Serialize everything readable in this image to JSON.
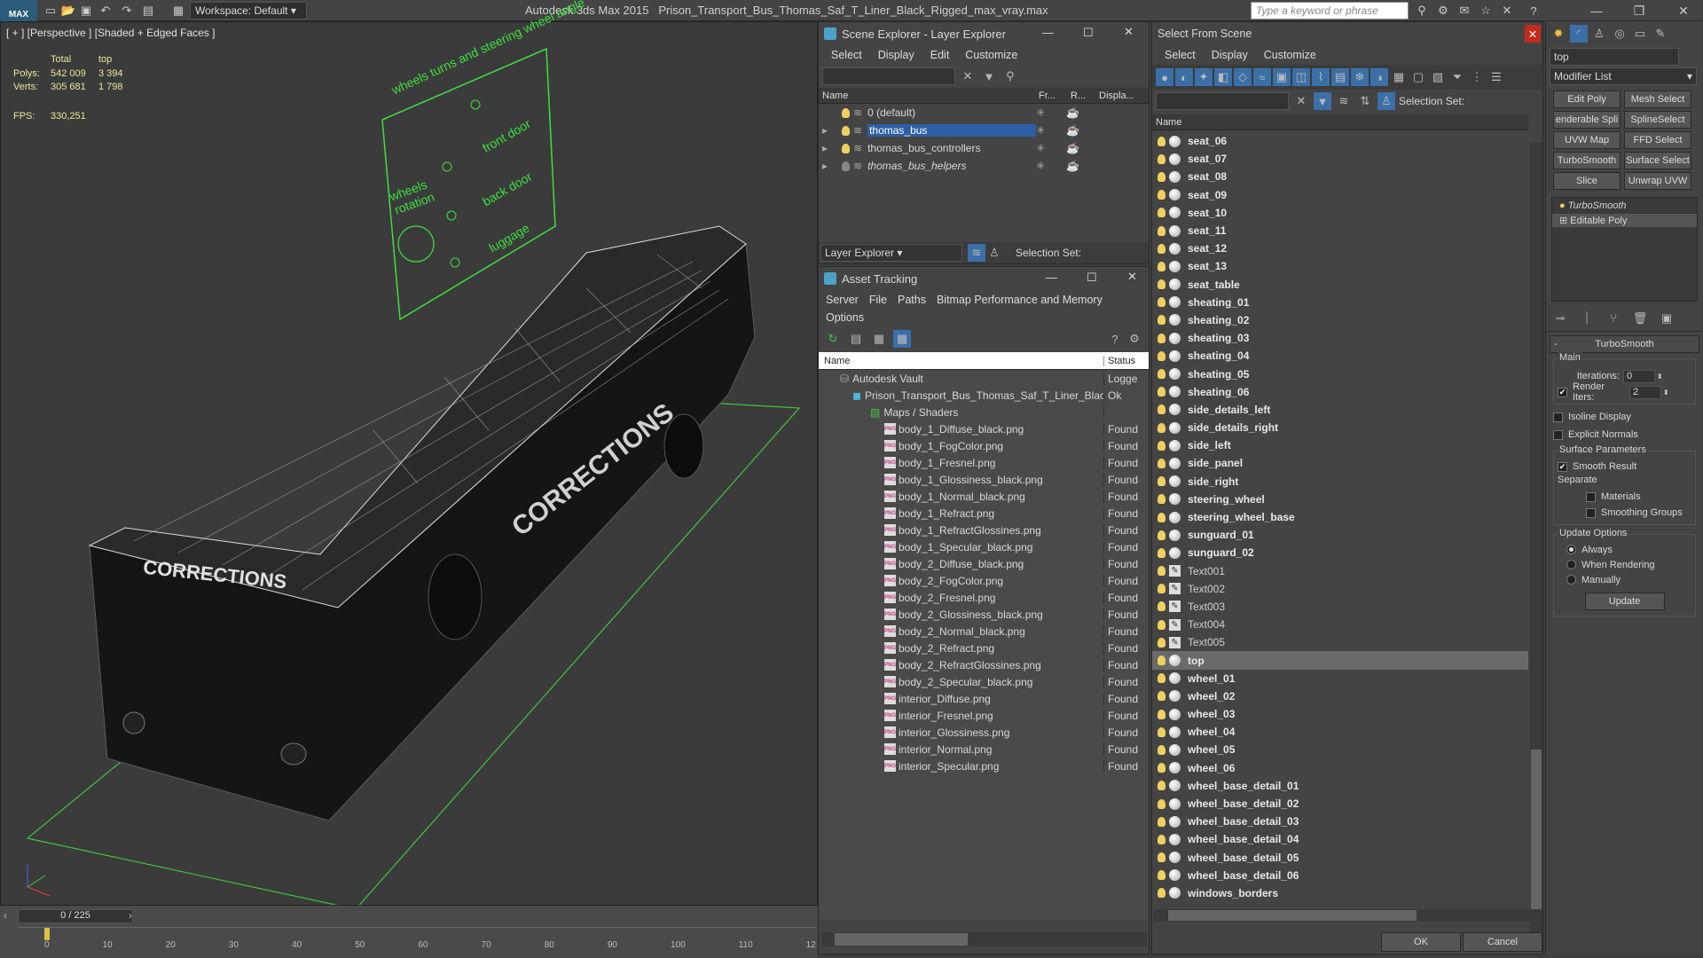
{
  "titlebar": {
    "logo": "MAX",
    "workspace": "Workspace: Default",
    "app_name": "Autodesk 3ds Max  2015",
    "file_name": "Prison_Transport_Bus_Thomas_Saf_T_Liner_Black_Rigged_max_vray.max",
    "search_placeholder": "Type a keyword or phrase"
  },
  "viewport": {
    "label": "[ + ] [Perspective ] [Shaded + Edged Faces ]",
    "stats": {
      "header_total": "Total",
      "header_sel": "top",
      "polys_label": "Polys:",
      "polys_total": "542 009",
      "polys_sel": "3 394",
      "verts_label": "Verts:",
      "verts_total": "305 681",
      "verts_sel": "1 798",
      "fps_label": "FPS:",
      "fps_value": "330,251"
    },
    "overlay_text": {
      "title": "wheels turns and steering wheel angle",
      "front_door": "front door",
      "back_door": "back door",
      "luggage": "luggage",
      "wheels_rotation": "wheels rotation"
    },
    "bus_text": "CORRECTIONS"
  },
  "timeline": {
    "frame": "0 / 225",
    "ticks": [
      "0",
      "10",
      "20",
      "30",
      "40",
      "50",
      "60",
      "70",
      "80",
      "90",
      "100",
      "110",
      "12"
    ]
  },
  "scene_explorer": {
    "title": "Scene Explorer - Layer Explorer",
    "menu": [
      "Select",
      "Display",
      "Edit",
      "Customize"
    ],
    "columns": [
      "Name",
      "Fr...",
      "R...",
      "Displa..."
    ],
    "layers": [
      "0 (default)",
      "thomas_bus",
      "thomas_bus_controllers",
      "thomas_bus_helpers"
    ],
    "footer_label": "Layer Explorer",
    "selection_set": "Selection Set:"
  },
  "asset_tracking": {
    "title": "Asset Tracking",
    "menu": [
      "Server",
      "File",
      "Paths",
      "Bitmap Performance and Memory"
    ],
    "menu2": "Options",
    "columns": [
      "Name",
      "Status"
    ],
    "vault": {
      "name": "Autodesk Vault",
      "status": "Logge"
    },
    "file": {
      "name": "Prison_Transport_Bus_Thomas_Saf_T_Liner_Black...",
      "status": "Ok"
    },
    "maps_label": "Maps / Shaders",
    "maps": [
      "body_1_Diffuse_black.png",
      "body_1_FogColor.png",
      "body_1_Fresnel.png",
      "body_1_Glossiness_black.png",
      "body_1_Normal_black.png",
      "body_1_Refract.png",
      "body_1_RefractGlossines.png",
      "body_1_Specular_black.png",
      "body_2_Diffuse_black.png",
      "body_2_FogColor.png",
      "body_2_Fresnel.png",
      "body_2_Glossiness_black.png",
      "body_2_Normal_black.png",
      "body_2_Refract.png",
      "body_2_RefractGlossines.png",
      "body_2_Specular_black.png",
      "interior_Diffuse.png",
      "interior_Fresnel.png",
      "interior_Glossiness.png",
      "interior_Normal.png",
      "interior_Specular.png"
    ],
    "found": "Found",
    "png": "PNG"
  },
  "select_from_scene": {
    "title": "Select From Scene",
    "menu": [
      "Select",
      "Display",
      "Customize"
    ],
    "selection_set": "Selection Set:",
    "column": "Name",
    "items": [
      "seat_06",
      "seat_07",
      "seat_08",
      "seat_09",
      "seat_10",
      "seat_11",
      "seat_12",
      "seat_13",
      "seat_table",
      "sheating_01",
      "sheating_02",
      "sheating_03",
      "sheating_04",
      "sheating_05",
      "sheating_06",
      "side_details_left",
      "side_details_right",
      "side_left",
      "side_panel",
      "side_right",
      "steering_wheel",
      "steering_wheel_base",
      "sunguard_01",
      "sunguard_02",
      "Text001",
      "Text002",
      "Text003",
      "Text004",
      "Text005",
      "top",
      "wheel_01",
      "wheel_02",
      "wheel_03",
      "wheel_04",
      "wheel_05",
      "wheel_06",
      "wheel_base_detail_01",
      "wheel_base_detail_02",
      "wheel_base_detail_03",
      "wheel_base_detail_04",
      "wheel_base_detail_05",
      "wheel_base_detail_06",
      "windows_borders"
    ],
    "selected_item": "top",
    "ok": "OK",
    "cancel": "Cancel"
  },
  "command_panel": {
    "object_name": "top",
    "modifier_list": "Modifier List",
    "buttons": [
      "Edit Poly",
      "Mesh Select",
      "enderable Spli",
      "SplineSelect",
      "UVW Map",
      "FFD Select",
      "TurboSmooth",
      "Surface Select",
      "Slice",
      "Unwrap UVW"
    ],
    "stack": [
      "TurboSmooth",
      "Editable Poly"
    ],
    "rollout_title": "TurboSmooth",
    "main_label": "Main",
    "iterations_label": "Iterations:",
    "iterations_value": "0",
    "render_iters_label": "Render Iters:",
    "render_iters_value": "2",
    "isoline": "Isoline Display",
    "explicit_normals": "Explicit Normals",
    "surface_params": "Surface Parameters",
    "smooth_result": "Smooth Result",
    "separate": "Separate",
    "materials": "Materials",
    "smoothing_groups": "Smoothing Groups",
    "update_options": "Update Options",
    "always": "Always",
    "when_rendering": "When Rendering",
    "manually": "Manually",
    "update": "Update"
  }
}
